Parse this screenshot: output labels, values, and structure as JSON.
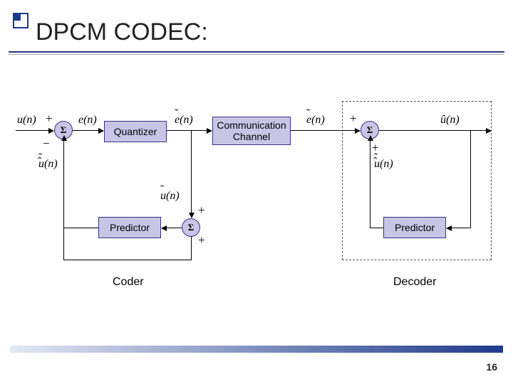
{
  "title": "DPCM CODEC:",
  "page_number": "16",
  "blocks": {
    "quantizer": "Quantizer",
    "predictor": "Predictor",
    "channel": "Communication\nChannel",
    "predictor2": "Predictor"
  },
  "sum_symbol": "Σ",
  "sections": {
    "coder": "Coder",
    "decoder": "Decoder"
  },
  "signs": {
    "plus": "+",
    "minus": "−"
  },
  "signals": {
    "u_n": "u(n)",
    "e_n": "e(n)",
    "etil_n": "e(n)",
    "utilhat_n": "u(n)",
    "utilhat_n2": "u(n)",
    "util_n": "u(n)",
    "etil_n2": "e(n)",
    "uhat_n": "û(n)"
  },
  "chart_data": {
    "type": "block_diagram",
    "title": "DPCM CODEC",
    "nodes": [
      {
        "id": "sum1",
        "kind": "summing",
        "inputs": [
          "+u(n)",
          "-ũ̂(n)"
        ],
        "output": "e(n)"
      },
      {
        "id": "quantizer",
        "kind": "block",
        "label": "Quantizer",
        "input": "e(n)",
        "output": "ẽ(n)"
      },
      {
        "id": "channel",
        "kind": "block",
        "label": "Communication Channel",
        "input": "ẽ(n)",
        "output": "ẽ(n)"
      },
      {
        "id": "sum2",
        "kind": "summing",
        "inputs": [
          "+ẽ(n)",
          "+ũ̂(n)"
        ],
        "output": "ũ(n)"
      },
      {
        "id": "predictor1",
        "kind": "block",
        "label": "Predictor",
        "input": "ũ(n)",
        "output": "ũ̂(n)"
      },
      {
        "id": "sum3",
        "kind": "summing",
        "inputs": [
          "+ẽ(n)",
          "+ũ̂(n)"
        ],
        "output": "û(n)"
      },
      {
        "id": "predictor2",
        "kind": "block",
        "label": "Predictor",
        "input": "û(n)",
        "output": "ũ̂(n)"
      }
    ],
    "groups": [
      {
        "label": "Coder",
        "nodes": [
          "sum1",
          "quantizer",
          "sum2",
          "predictor1"
        ]
      },
      {
        "label": "Decoder",
        "nodes": [
          "sum3",
          "predictor2"
        ]
      }
    ]
  }
}
